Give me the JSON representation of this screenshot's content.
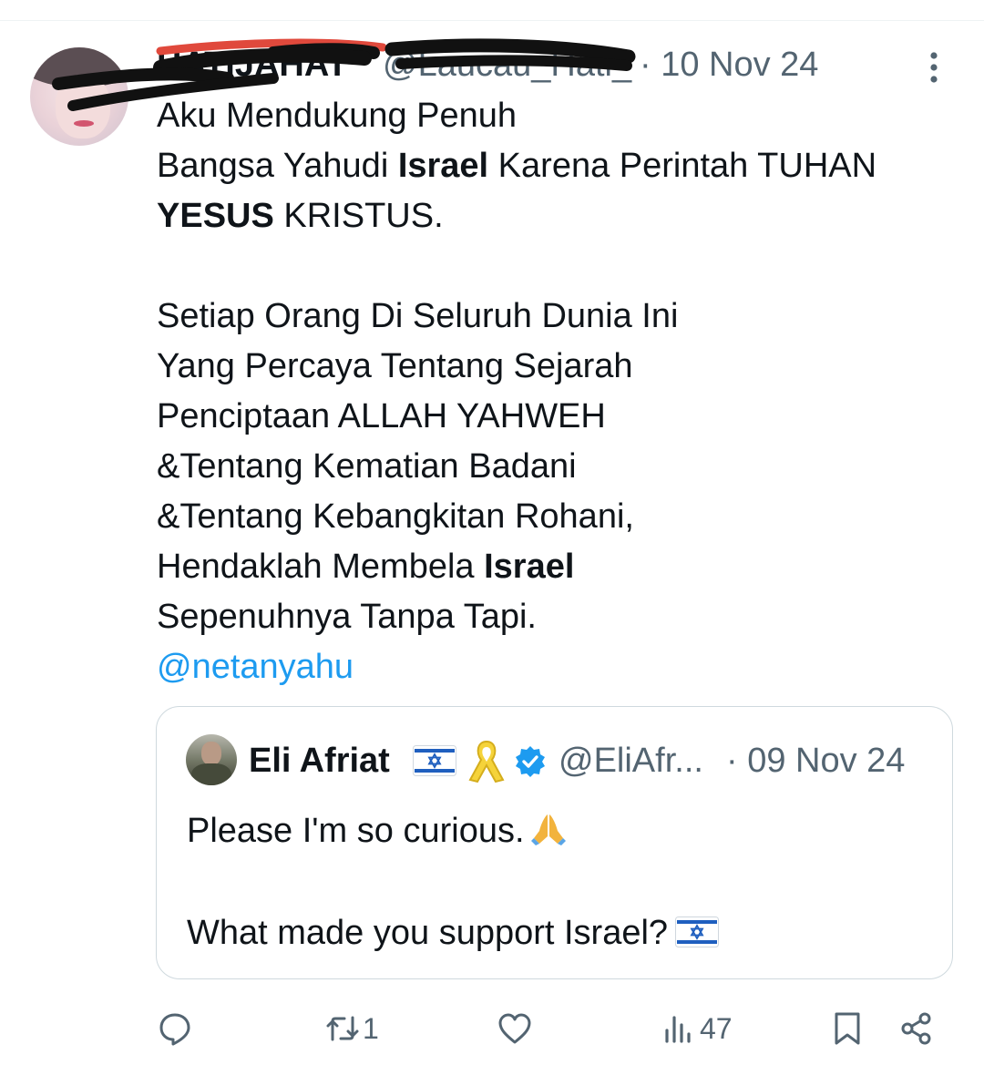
{
  "tweet": {
    "author_name": "HATIJAHAT",
    "author_handle": "@Laucau_Hati_",
    "date": "· 10 Nov 24",
    "body": {
      "l1": "Aku Mendukung Penuh",
      "l2a": "Bangsa Yahudi ",
      "l2b": "Israel",
      "l2c": " Karena Perintah TUHAN",
      "l3a": "YESUS",
      "l3b": " KRISTUS.",
      "l4": "Setiap Orang Di Seluruh Dunia Ini",
      "l5": "Yang Percaya Tentang Sejarah",
      "l6": "Penciptaan ALLAH YAHWEH",
      "l7": "&Tentang Kematian Badani",
      "l8": "&Tentang Kebangkitan Rohani,",
      "l9a": "Hendaklah Membela ",
      "l9b": "Israel",
      "l10": "Sepenuhnya Tanpa Tapi.",
      "mention": "@netanyahu"
    }
  },
  "quote": {
    "name": "Eli Afriat",
    "handle": "@EliAfr...",
    "date": "· 09 Nov 24",
    "line1": "Please I'm so curious.",
    "line2": "What made you support Israel?"
  },
  "actions": {
    "retweet_count": "1",
    "views_count": "47"
  },
  "icons": [
    "more-icon",
    "flag-icon",
    "ribbon-icon",
    "verified-icon",
    "pray-icon",
    "reply-icon",
    "retweet-icon",
    "like-icon",
    "views-icon",
    "bookmark-icon",
    "share-icon"
  ],
  "colors": {
    "text": "#0f1419",
    "secondary": "#536471",
    "accent": "#1d9bf0",
    "border": "#cfd9de"
  }
}
